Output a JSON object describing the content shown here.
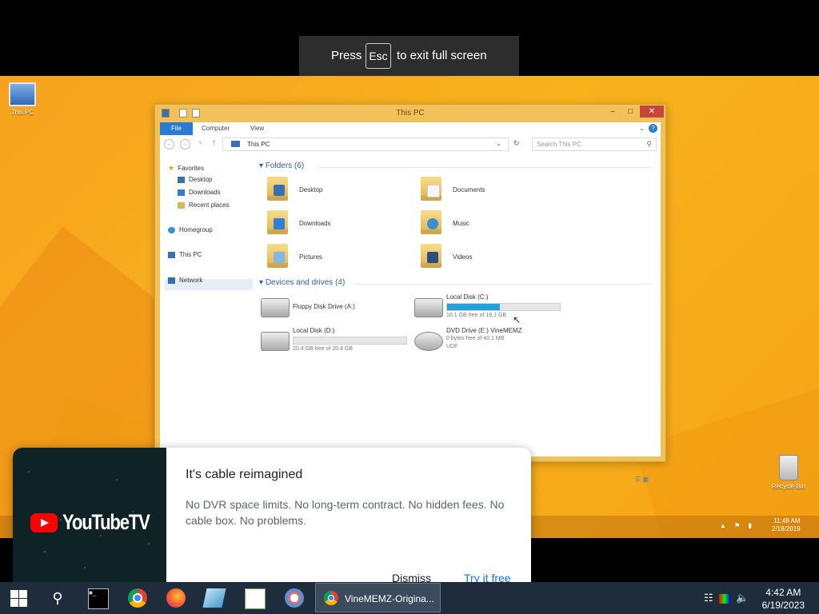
{
  "fullscreen_hint": {
    "press": "Press",
    "key": "Esc",
    "rest": "to exit full screen"
  },
  "video": {
    "desktop_icons": {
      "this_pc": "This PC",
      "recycle_bin": "Recycle Bin"
    },
    "explorer": {
      "title": "This PC",
      "ribbon_tabs": [
        "File",
        "Computer",
        "View"
      ],
      "address": "This PC",
      "search_placeholder": "Search This PC",
      "nav": {
        "favorites": "Favorites",
        "desktop": "Desktop",
        "downloads": "Downloads",
        "recent": "Recent places",
        "homegroup": "Homegroup",
        "this_pc": "This PC",
        "network": "Network"
      },
      "folders_header": "Folders (6)",
      "folders": [
        "Desktop",
        "Documents",
        "Downloads",
        "Music",
        "Pictures",
        "Videos"
      ],
      "drives_header": "Devices and drives (4)",
      "drives": {
        "floppy": {
          "name": "Floppy Disk Drive (A:)"
        },
        "c": {
          "name": "Local Disk (C:)",
          "free": "10.1 GB free of 19.1 GB",
          "used_fraction": 0.47
        },
        "d": {
          "name": "Local Disk (D:)",
          "free": "20.4 GB free of 20.4 GB",
          "used_fraction": 0.0
        },
        "e": {
          "name": "DVD Drive (E:) VineMEMZ",
          "free": "0 bytes free of 40.1 MB",
          "fs": "UDF"
        }
      }
    },
    "inner_clock": {
      "time": "11:48 AM",
      "date": "2/18/2019"
    }
  },
  "promo": {
    "brand": "YouTubeTV",
    "title": "It's cable reimagined",
    "body": "No DVR space limits. No long-term contract. No hidden fees. No cable box. No problems.",
    "dismiss": "Dismiss",
    "try_free": "Try it free"
  },
  "taskbar": {
    "active_task": "VineMEMZ-Origina...",
    "clock_time": "4:42 AM",
    "clock_date": "6/19/2023"
  }
}
